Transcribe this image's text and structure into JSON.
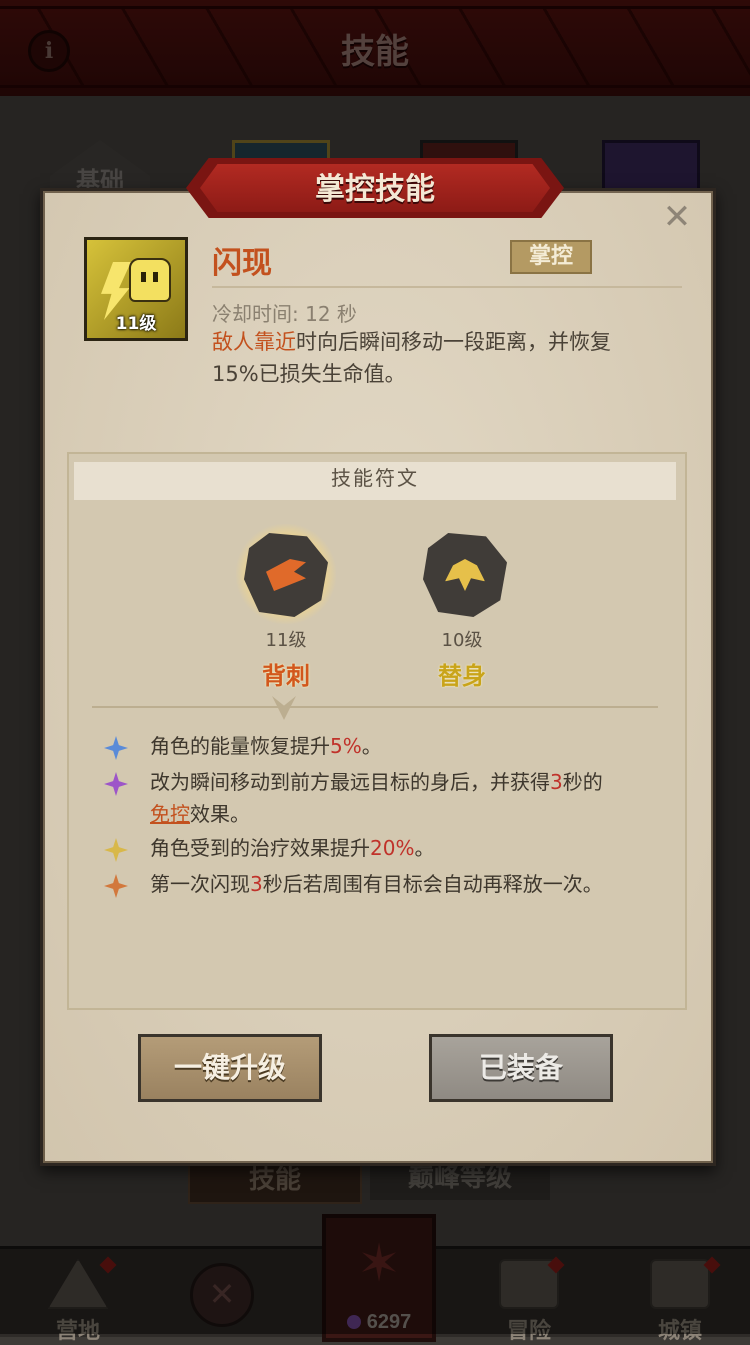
{
  "header": {
    "title": "技能",
    "info_icon": "info-icon"
  },
  "background": {
    "tab_basic": "基础",
    "bottom_tabs": [
      "技能",
      "巅峰等级"
    ]
  },
  "nav": {
    "camp": "营地",
    "adventure": "冒险",
    "town": "城镇",
    "currency": "6297"
  },
  "modal": {
    "title": "掌控技能",
    "close_icon": "close-icon",
    "skill": {
      "name": "闪现",
      "tag": "掌控",
      "level": "11级",
      "cooldown": "冷却时间: 12 秒",
      "desc_highlight": "敌人靠近",
      "desc_rest": "时向后瞬间移动一段距离，并恢复15%已损失生命值。"
    },
    "runes_title": "技能符文",
    "runes": [
      {
        "level": "11级",
        "name": "背刺"
      },
      {
        "level": "10级",
        "name": "替身"
      }
    ],
    "effects": [
      {
        "pre": "角色的能量恢复提升",
        "num": "5%",
        "post": "。"
      },
      {
        "pre": "改为瞬间移动到前方最远目标的身后，并获得",
        "num": "3",
        "mid": "秒的",
        "link": "免控",
        "post": "效果。"
      },
      {
        "pre": "角色受到的治疗效果提升",
        "num": "20%",
        "post": "。"
      },
      {
        "pre": "第一次闪现",
        "num": "3",
        "post": "秒后若周围有目标会自动再释放一次。"
      }
    ],
    "buttons": {
      "upgrade": "一键升级",
      "equipped": "已装备"
    }
  },
  "colors": {
    "accent_red": "#b22a22",
    "highlight_orange": "#c3511e",
    "number_red": "#c0322a"
  }
}
